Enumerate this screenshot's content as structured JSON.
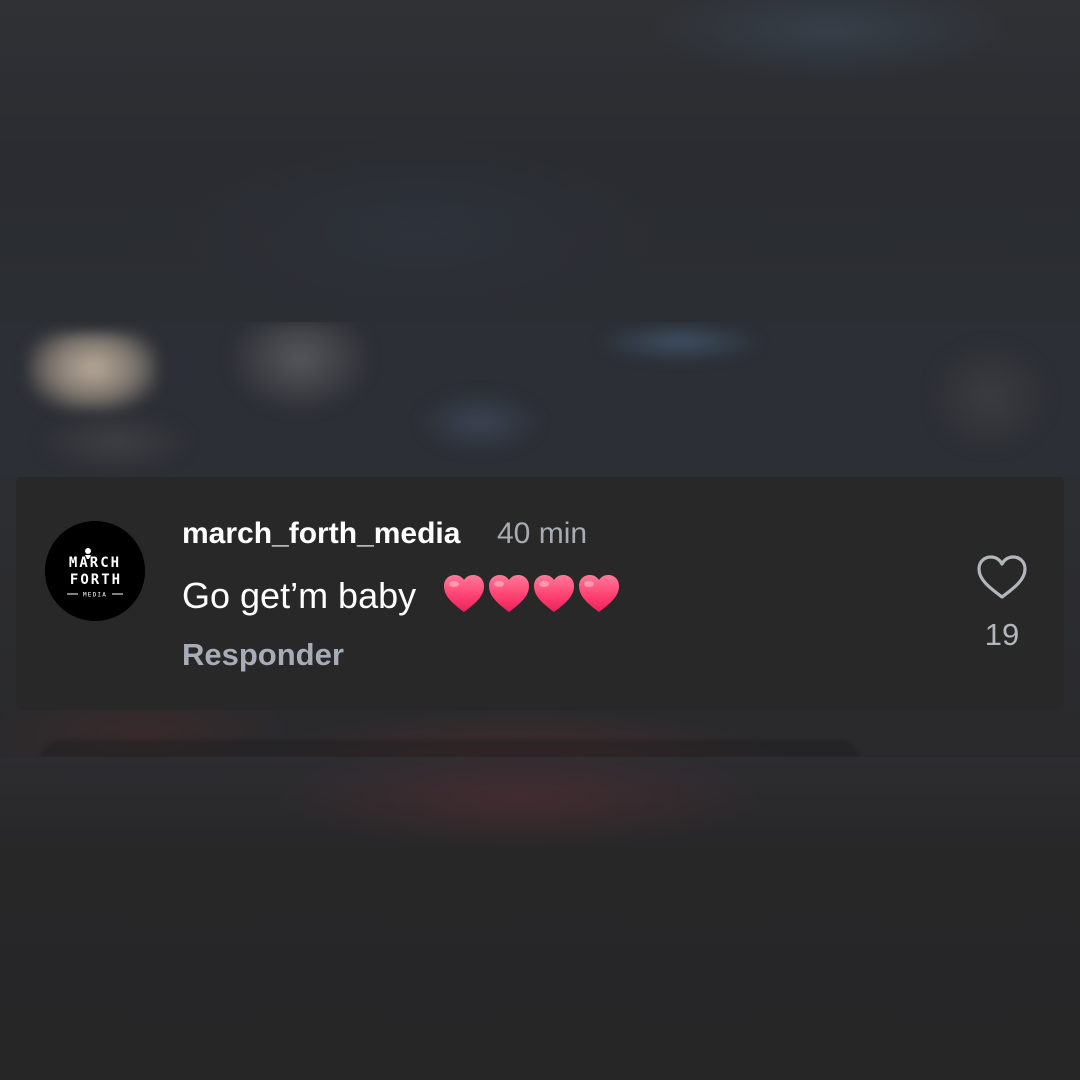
{
  "comment": {
    "username": "march_forth_media",
    "timestamp": "40 min",
    "text": "Go get’m baby",
    "emoji": [
      "heart-emoji",
      "heart-emoji",
      "heart-emoji",
      "heart-emoji"
    ],
    "reply_label": "Responder",
    "like_count": "19"
  },
  "avatar": {
    "logo_text": [
      "MARCH",
      "FORTH",
      "MEDIA"
    ],
    "icon": "march-forth-media-logo"
  },
  "icons": {
    "like": "heart-outline-icon"
  },
  "colors": {
    "card_background": "#282828",
    "username": "#ffffff",
    "secondary_text": "#a8abb2",
    "emoji_heart": "#ff3d6e"
  }
}
